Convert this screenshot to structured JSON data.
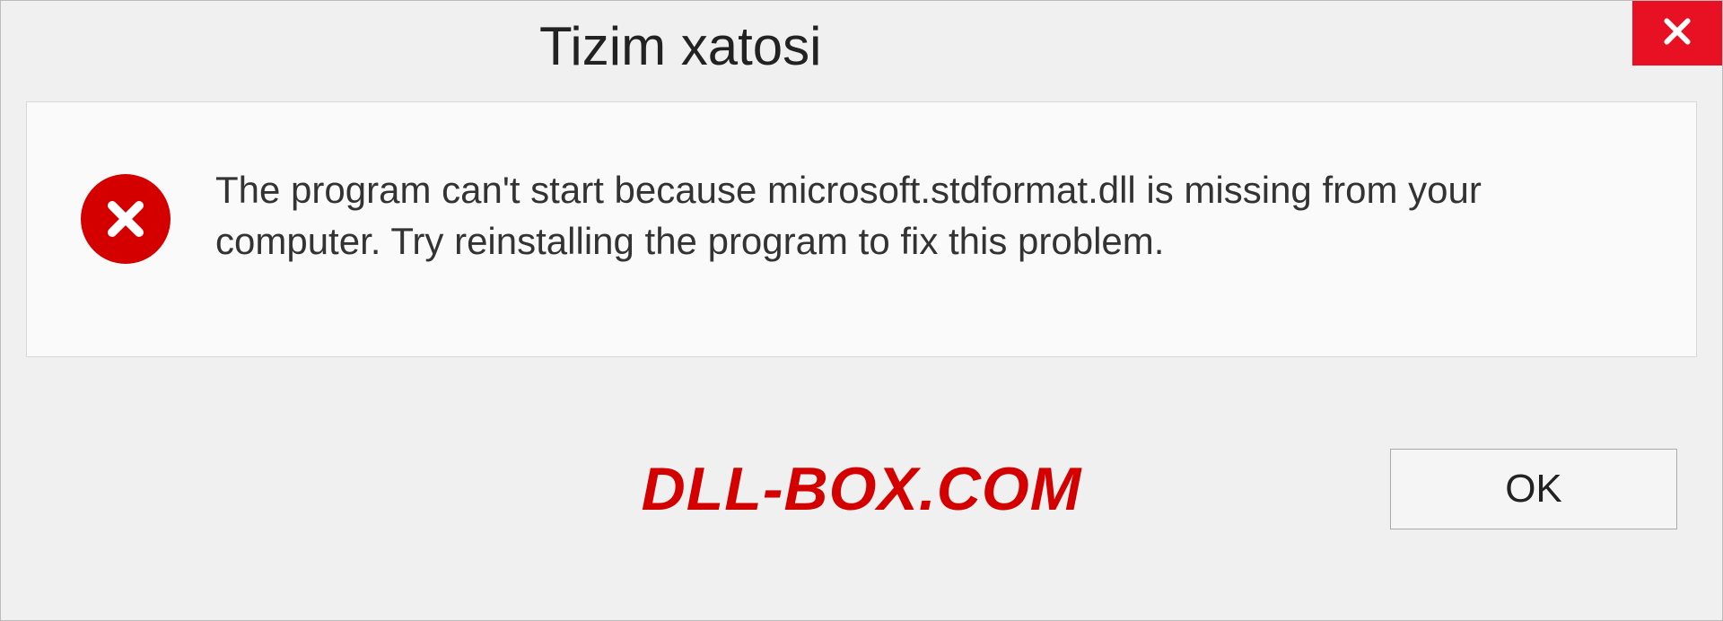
{
  "dialog": {
    "title": "Tizim xatosi",
    "message": "The program can't start because microsoft.stdformat.dll is missing from your computer. Try reinstalling the program to fix this problem.",
    "ok_label": "OK",
    "watermark": "DLL-BOX.COM"
  }
}
